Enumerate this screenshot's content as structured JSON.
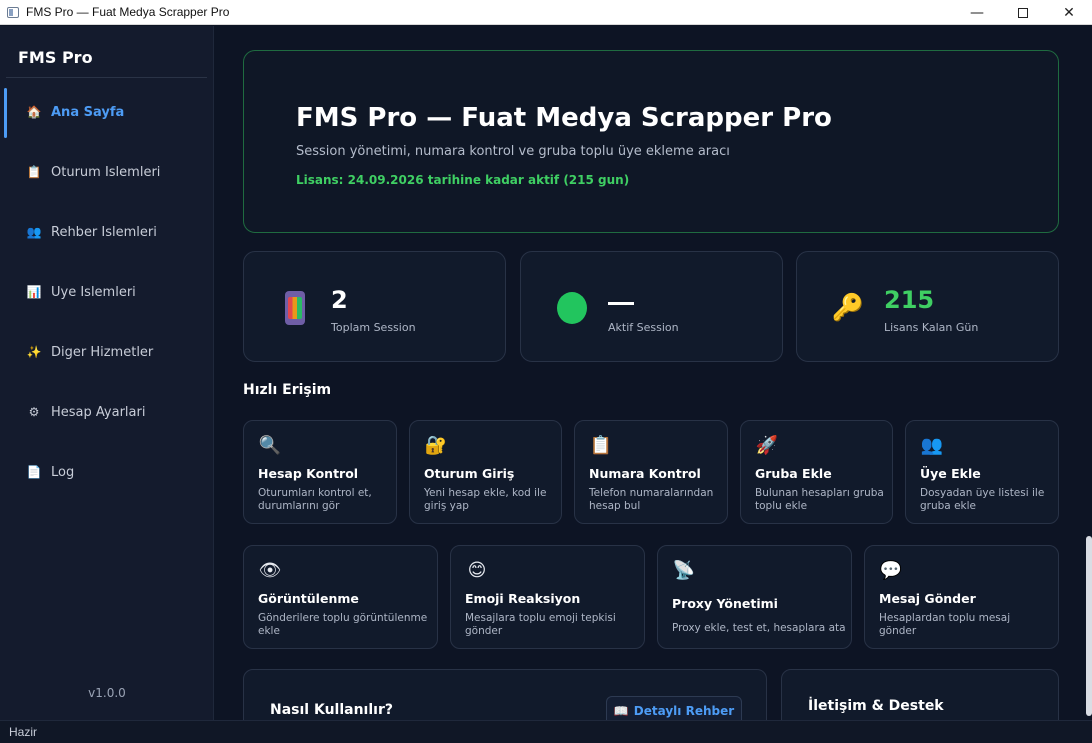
{
  "window": {
    "title": "FMS Pro — Fuat Medya Scrapper Pro",
    "minimize": "—",
    "close": "✕"
  },
  "sidebar": {
    "brand": "FMS Pro",
    "version": "v1.0.0",
    "items": [
      {
        "label": "Ana Sayfa",
        "icon": "🏠",
        "active": true
      },
      {
        "label": "Oturum Islemleri",
        "icon": "📋"
      },
      {
        "label": "Rehber Islemleri",
        "icon": "👥"
      },
      {
        "label": "Uye Islemleri",
        "icon": "📊"
      },
      {
        "label": "Diger Hizmetler",
        "icon": "✨"
      },
      {
        "label": "Hesap Ayarlari",
        "icon": "⚙"
      },
      {
        "label": "Log",
        "icon": "📄"
      }
    ]
  },
  "hero": {
    "title": "FMS Pro — Fuat Medya Scrapper Pro",
    "subtitle": "Session yönetimi, numara kontrol ve gruba toplu üye ekleme aracı",
    "license": "Lisans: 24.09.2026 tarihine kadar aktif (215 gun)"
  },
  "stats": [
    {
      "value": "2",
      "label": "Toplam Session",
      "icon": "phone-icon"
    },
    {
      "value": "",
      "label": "Aktif Session",
      "icon": "green-dot-icon"
    },
    {
      "value": "215",
      "label": "Lisans Kalan Gün",
      "icon": "key-icon",
      "color": "#3fcf63"
    }
  ],
  "quick_access": {
    "title": "Hızlı Erişim",
    "cards": [
      {
        "title": "Hesap Kontrol",
        "desc": "Oturumları kontrol et, durumlarını gör",
        "icon": "🔍"
      },
      {
        "title": "Oturum Giriş",
        "desc": "Yeni hesap ekle, kod ile giriş yap",
        "icon": "🔐"
      },
      {
        "title": "Numara Kontrol",
        "desc": "Telefon numaralarından hesap bul",
        "icon": "📋"
      },
      {
        "title": "Gruba Ekle",
        "desc": "Bulunan hesapları gruba toplu ekle",
        "icon": "🚀"
      },
      {
        "title": "Üye Ekle",
        "desc": "Dosyadan üye listesi ile gruba ekle",
        "icon": "👥"
      },
      {
        "title": "Görüntülenme",
        "desc": "Gönderilere toplu görüntülenme ekle",
        "icon": "👁"
      },
      {
        "title": "Emoji Reaksiyon",
        "desc": "Mesajlara toplu emoji tepkisi gönder",
        "icon": "😊"
      },
      {
        "title": "Proxy Yönetimi",
        "desc": "Proxy ekle, test et, hesaplara ata",
        "icon": "📡"
      },
      {
        "title": "Mesaj Gönder",
        "desc": "Hesaplardan toplu mesaj gönder",
        "icon": "💬"
      }
    ]
  },
  "help": {
    "title": "Nasıl Kullanılır?",
    "guide_button": "Detaylı Rehber",
    "guide_icon": "📖"
  },
  "contact": {
    "title": "İletişim & Destek"
  },
  "status": "Hazir"
}
